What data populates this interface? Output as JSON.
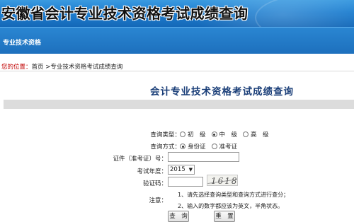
{
  "banner": {
    "title": "安徽省会计专业技术资格考试成绩查询"
  },
  "subbar": {
    "title": "专业技术资格"
  },
  "breadcrumb": {
    "label": "您的位置：",
    "home": "首页",
    "separator": " >",
    "current": "专业技术资格考试成绩查询"
  },
  "page_heading": "会计专业技术资格考试成绩查询",
  "form": {
    "type_label": "查询类型：",
    "type_options": [
      "初　级",
      "中　级",
      "高　级"
    ],
    "type_selected": "中　级",
    "method_label": "查询方式：",
    "method_options": [
      "身份证",
      "准考证"
    ],
    "method_selected": "身份证",
    "id_label": "证件（准考证）号：",
    "id_value": "",
    "year_label": "考试年度：",
    "year_value": "2015",
    "captcha_label": "验证码：",
    "captcha_value": "",
    "captcha_text": "1618",
    "note_label": "注意：",
    "notes": [
      "1、请先选择查询类型和查询方式进行查分；",
      "2、输入的数字都应该为英文，半角状态。"
    ],
    "query_button": "查　询",
    "reset_button": "重　置"
  },
  "colors": {
    "banner": "#1f7fd0",
    "heading": "#1a3e78",
    "crumb_label": "#c00000"
  }
}
